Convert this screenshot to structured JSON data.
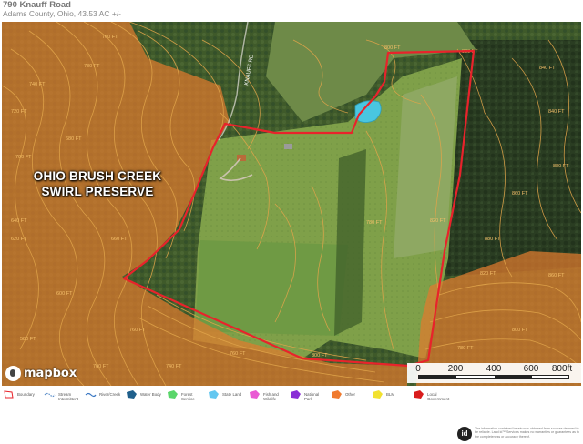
{
  "header": {
    "title": "790 Knauff Road",
    "subtitle": "Adams County, Ohio, 43.53 AC +/-"
  },
  "map": {
    "preserve_label_line1": "OHIO BRUSH CREEK",
    "preserve_label_line2": "SWIRL PRESERVE",
    "road_label": "KNAUFF RD",
    "contour_labels": [
      "800 FT",
      "820 FT",
      "840 FT",
      "760 FT",
      "780 FT",
      "740 FT",
      "720 FT",
      "700 FT",
      "680 FT",
      "660 FT",
      "640 FT",
      "620 FT",
      "600 FT",
      "580 FT",
      "760 FT",
      "800 FT",
      "820 FT",
      "780 FT",
      "840 FT",
      "860 FT",
      "880 FT",
      "880 FT",
      "860 FT",
      "820 FT",
      "800 FT",
      "780 FT",
      "760 FT",
      "740 FT",
      "700 FT",
      "680 FT"
    ],
    "attribution": "mapbox",
    "colors": {
      "preserve_fill": "#e07a2e",
      "boundary": "#e8232b",
      "contour": "#e0a44a",
      "pond": "#49c6e0"
    }
  },
  "scale": {
    "ticks": [
      "0",
      "200",
      "400",
      "600",
      "800ft"
    ]
  },
  "legend": [
    {
      "label": "Boundary",
      "color": "#e8232b",
      "icon": "boundary-icon"
    },
    {
      "label": "Stream Intermittent",
      "color": "#5d8fc9",
      "icon": "stream-icon"
    },
    {
      "label": "River/Creek",
      "color": "#3b78c3",
      "icon": "river-icon"
    },
    {
      "label": "Water Body",
      "color": "#1f5f8b",
      "icon": "water-body-icon"
    },
    {
      "label": "Forest Service",
      "color": "#5ad66a",
      "icon": "forest-icon"
    },
    {
      "label": "State Land",
      "color": "#63c7f0",
      "icon": "state-land-icon"
    },
    {
      "label": "Fish and Wildlife",
      "color": "#e95ad3",
      "icon": "wildlife-icon"
    },
    {
      "label": "National Park",
      "color": "#8a2fd6",
      "icon": "national-park-icon"
    },
    {
      "label": "Other",
      "color": "#f07a2e",
      "icon": "other-icon"
    },
    {
      "label": "BLM",
      "color": "#f2e12e",
      "icon": "blm-icon"
    },
    {
      "label": "Local Government",
      "color": "#d91c1c",
      "icon": "local-government-icon"
    }
  ],
  "disclaimer": {
    "badge": "id",
    "text": "The information contained herein was obtained from sources deemed to be reliable. Land id™ Services makes no warranties or guarantees as to the completeness or accuracy thereof."
  }
}
